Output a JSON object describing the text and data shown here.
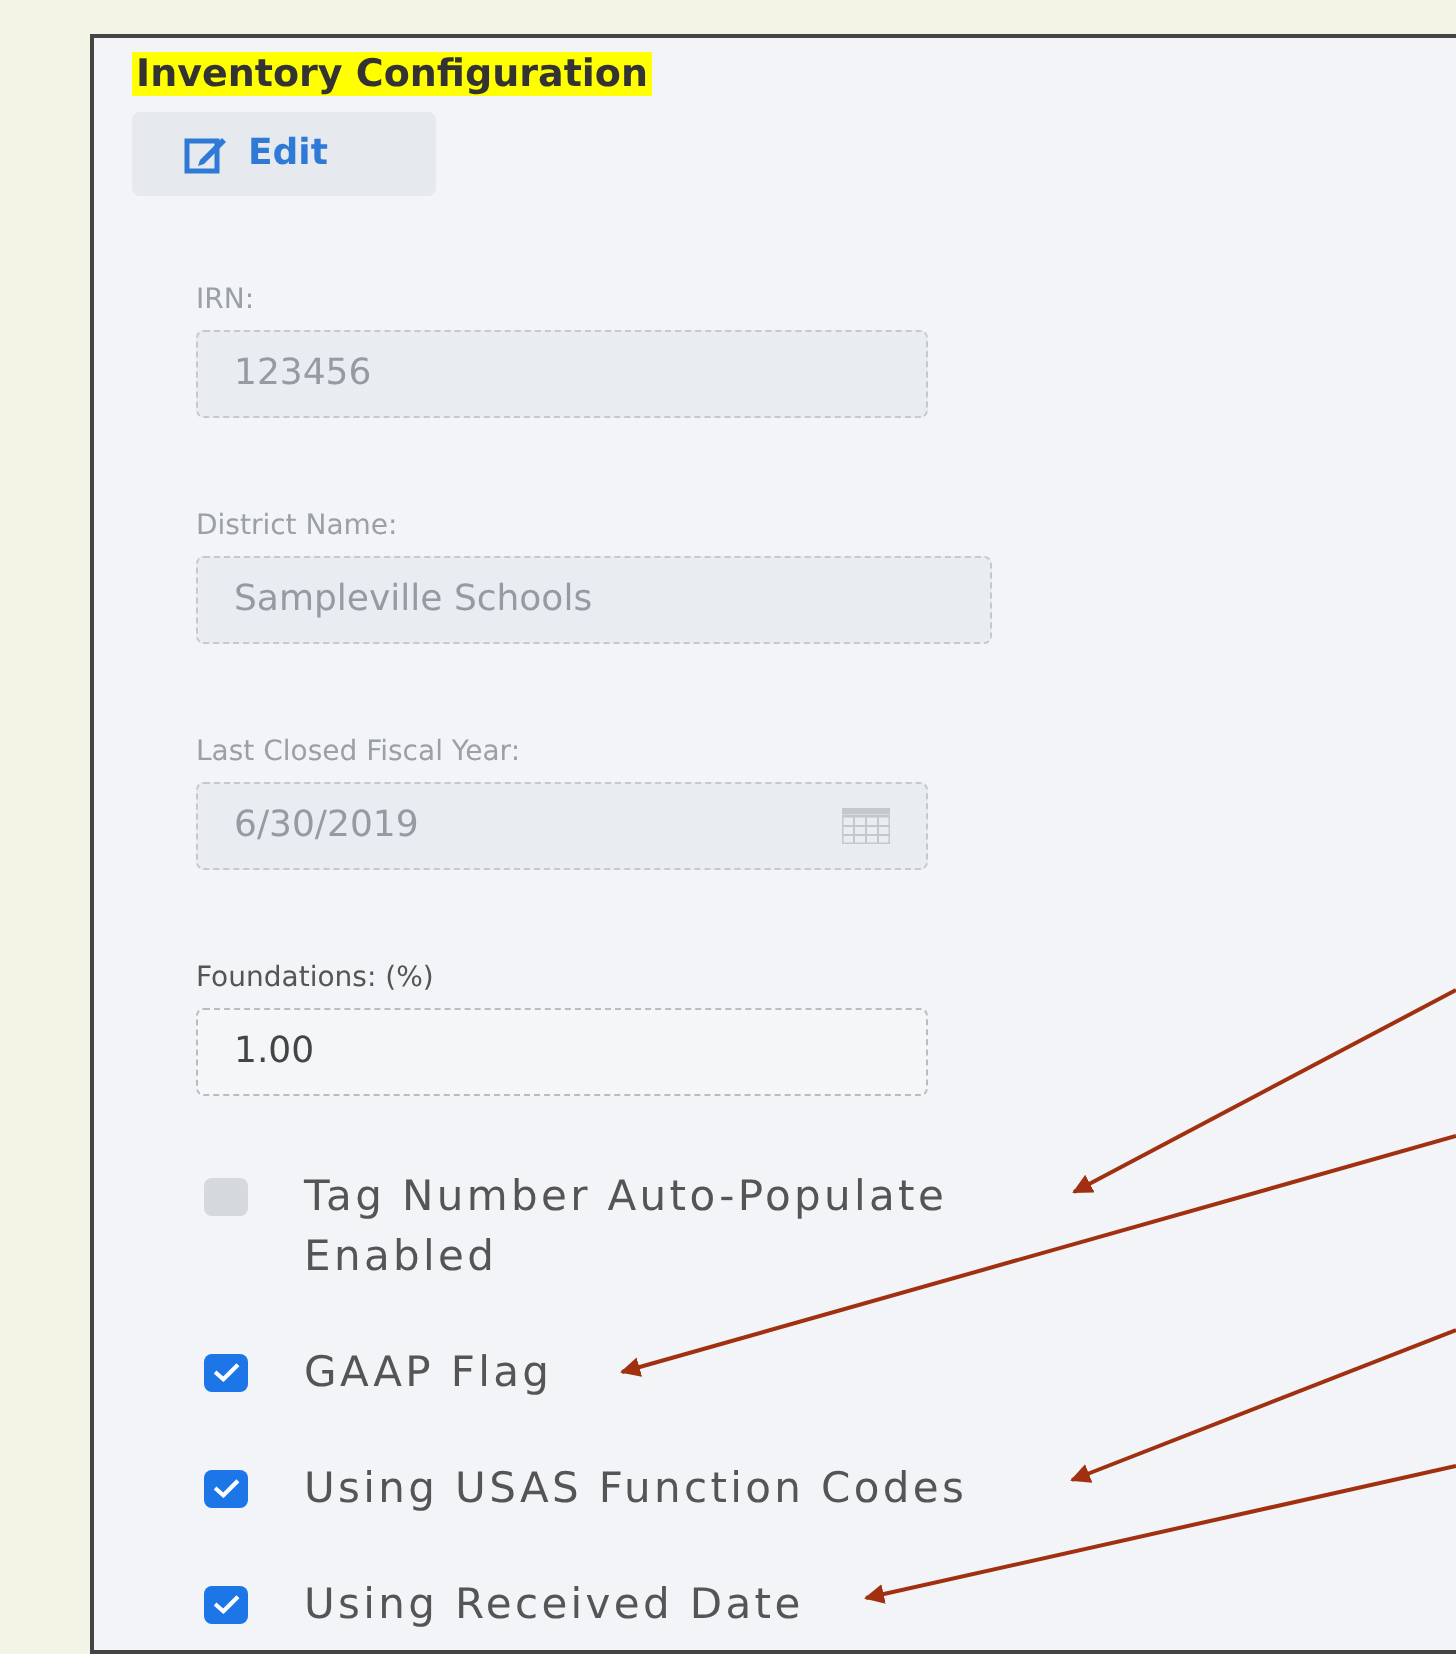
{
  "title": "Inventory Configuration",
  "edit_button": {
    "label": "Edit"
  },
  "fields": [
    {
      "label": "IRN:",
      "value": "123456",
      "disabled": true,
      "kind": "text"
    },
    {
      "label": "District Name:",
      "value": "Sampleville Schools",
      "disabled": true,
      "kind": "text"
    },
    {
      "label": "Last Closed Fiscal Year:",
      "value": "6/30/2019",
      "disabled": true,
      "kind": "date"
    },
    {
      "label": "Foundations: (%)",
      "value": "1.00",
      "disabled": false,
      "kind": "text"
    }
  ],
  "checkboxes": [
    {
      "label": "Tag Number Auto-Populate Enabled",
      "checked": false
    },
    {
      "label": "GAAP Flag",
      "checked": true
    },
    {
      "label": "Using USAS Function Codes",
      "checked": true
    },
    {
      "label": "Using Received Date",
      "checked": true
    }
  ]
}
